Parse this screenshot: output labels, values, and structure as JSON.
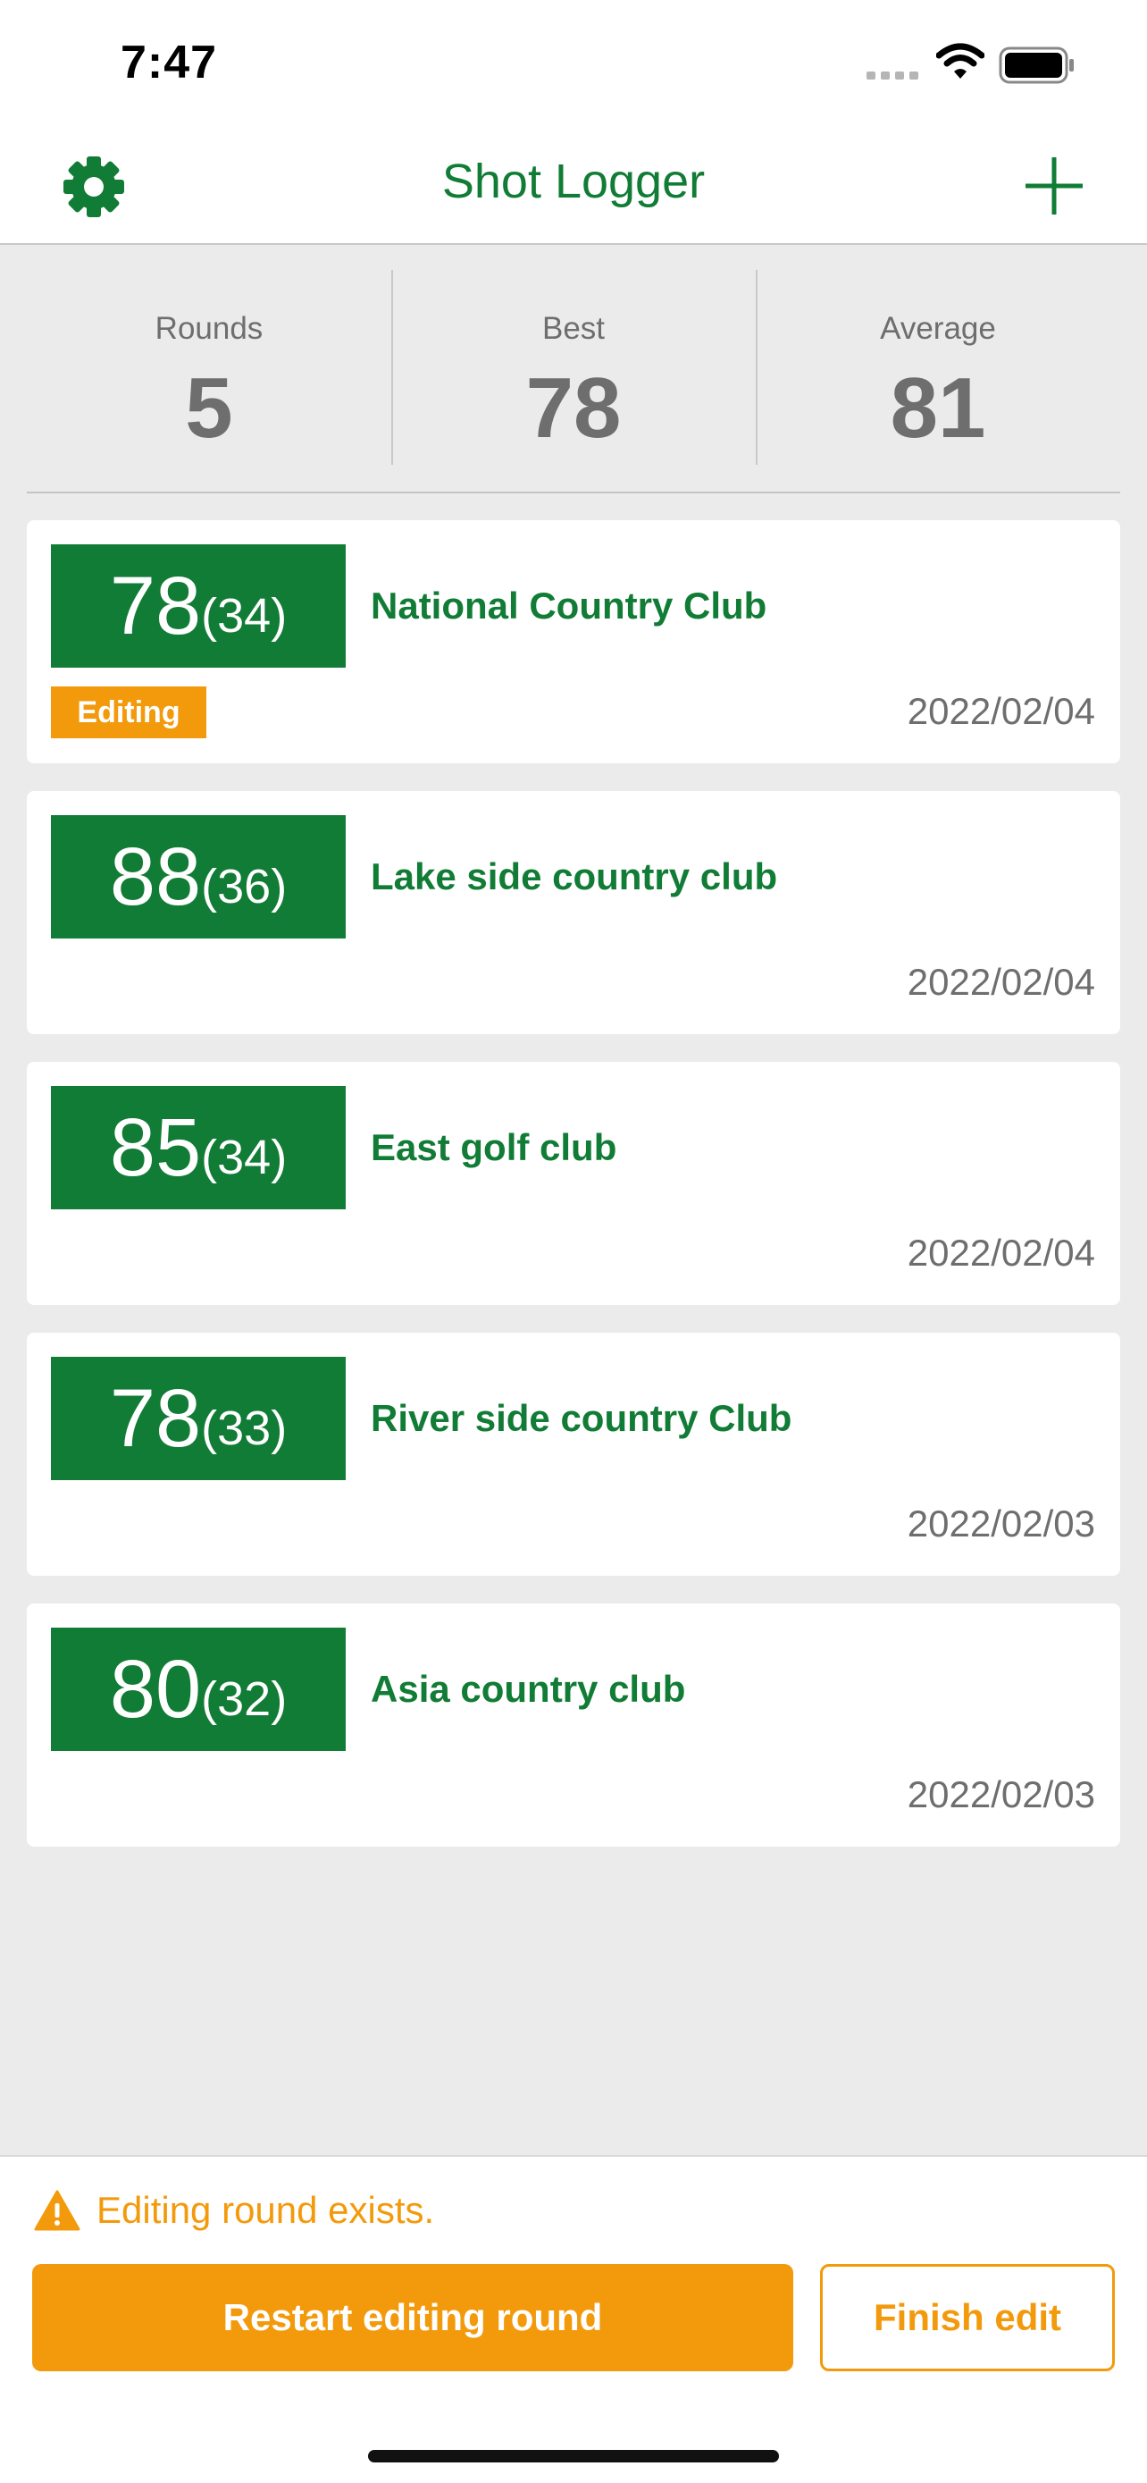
{
  "status_bar": {
    "time": "7:47",
    "icons": [
      "signal-icon",
      "wifi-icon",
      "battery-icon"
    ]
  },
  "nav": {
    "title": "Shot Logger",
    "left_icon": "gear-icon",
    "right_icon": "plus-icon"
  },
  "stats": [
    {
      "label": "Rounds",
      "value": "5"
    },
    {
      "label": "Best",
      "value": "78"
    },
    {
      "label": "Average",
      "value": "81"
    }
  ],
  "rounds": [
    {
      "score": "78",
      "sub": "(34)",
      "course": "National Country Club",
      "date": "2022/02/04",
      "badge": "Editing"
    },
    {
      "score": "88",
      "sub": "(36)",
      "course": "Lake side country club",
      "date": "2022/02/04"
    },
    {
      "score": "85",
      "sub": "(34)",
      "course": "East golf club",
      "date": "2022/02/04"
    },
    {
      "score": "78",
      "sub": "(33)",
      "course": "River side country Club",
      "date": "2022/02/03"
    },
    {
      "score": "80",
      "sub": "(32)",
      "course": "Asia country club",
      "date": "2022/02/03"
    }
  ],
  "bottom": {
    "warning_text": "Editing round exists.",
    "restart_label": "Restart editing round",
    "finish_label": "Finish edit"
  },
  "colors": {
    "brand_green": "#117c35",
    "accent_orange": "#f39a0c",
    "background": "#ebebeb"
  }
}
